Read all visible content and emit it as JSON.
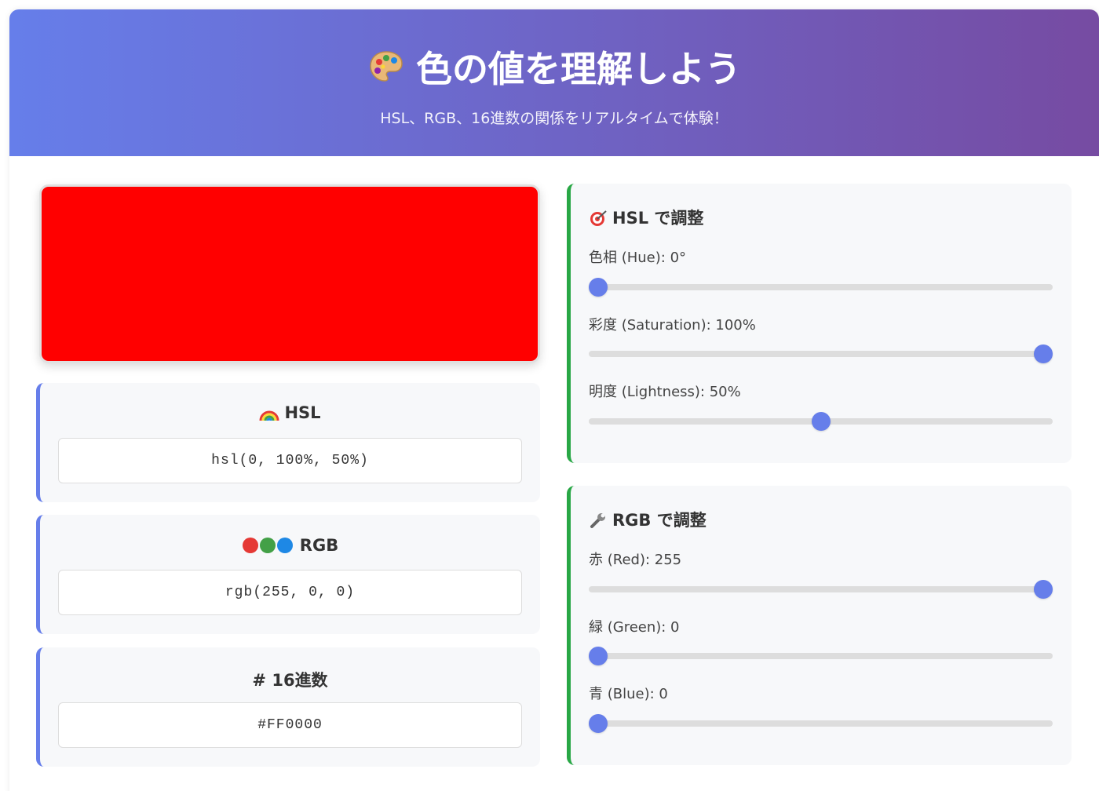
{
  "header": {
    "title": "色の値を理解しよう",
    "subtitle": "HSL、RGB、16進数の関係をリアルタイムで体験！",
    "icon": "palette-icon"
  },
  "preview": {
    "color": "#FF0000"
  },
  "values": {
    "hsl": {
      "title": "HSL",
      "icon": "rainbow-icon",
      "value": "hsl(0, 100%, 50%)"
    },
    "rgb": {
      "title": "RGB",
      "icon": "rgb-circles-icon",
      "value": "rgb(255, 0, 0)"
    },
    "hex": {
      "title": "# 16進数",
      "value": "#FF0000"
    }
  },
  "hsl_panel": {
    "title": "HSL で調整",
    "icon": "target-icon",
    "hue": {
      "label": "色相 (Hue): 0°",
      "value": 0,
      "min": 0,
      "max": 360
    },
    "saturation": {
      "label": "彩度 (Saturation): 100%",
      "value": 100,
      "min": 0,
      "max": 100
    },
    "lightness": {
      "label": "明度 (Lightness): 50%",
      "value": 50,
      "min": 0,
      "max": 100
    }
  },
  "rgb_panel": {
    "title": "RGB で調整",
    "icon": "wrench-icon",
    "red": {
      "label": "赤 (Red): 255",
      "value": 255,
      "min": 0,
      "max": 255
    },
    "green": {
      "label": "緑 (Green): 0",
      "value": 0,
      "min": 0,
      "max": 255
    },
    "blue": {
      "label": "青 (Blue): 0",
      "value": 0,
      "min": 0,
      "max": 255
    }
  },
  "colors": {
    "header_gradient_start": "#667eea",
    "header_gradient_end": "#764ba2",
    "value_accent": "#667eea",
    "control_accent": "#28a745",
    "slider_thumb": "#667eea"
  }
}
